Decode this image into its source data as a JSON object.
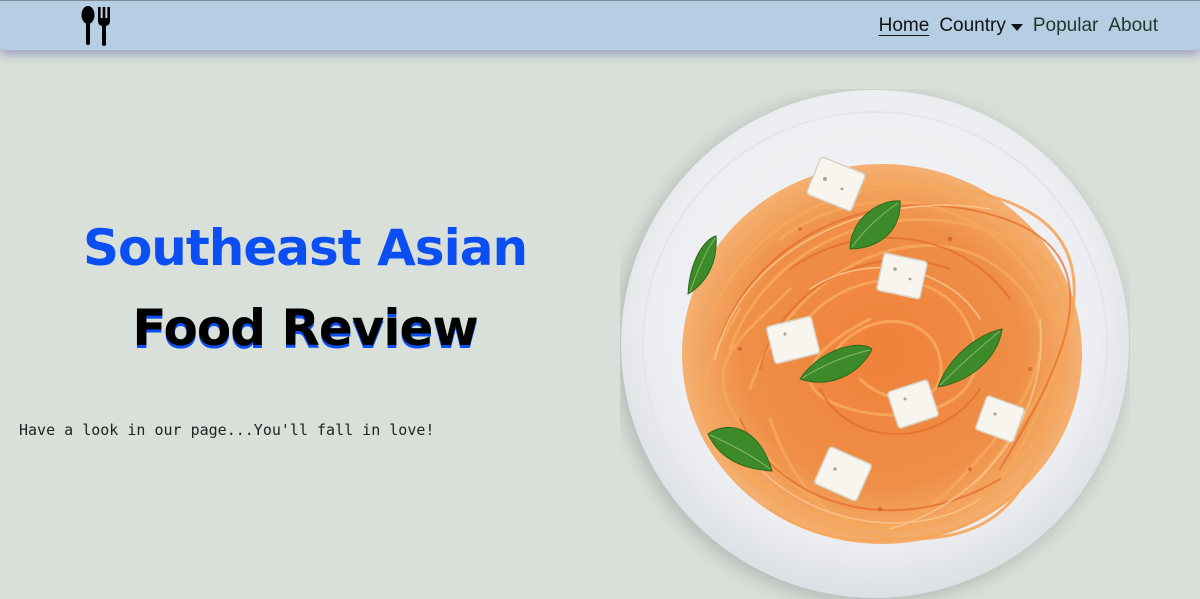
{
  "nav": {
    "logo_icon": "spoon-fork-icon",
    "links": {
      "home": "Home",
      "country": "Country",
      "popular": "Popular",
      "about": "About"
    }
  },
  "hero": {
    "title_line1": "Southeast Asian",
    "title_line2": "Food Review",
    "tagline": "Have a look in our page...You'll fall in love!",
    "image": "spaghetti-plate-image"
  },
  "colors": {
    "navbar": "#b5cee4",
    "background": "#d9e0d9",
    "accent_blue": "#0b4ff2"
  }
}
